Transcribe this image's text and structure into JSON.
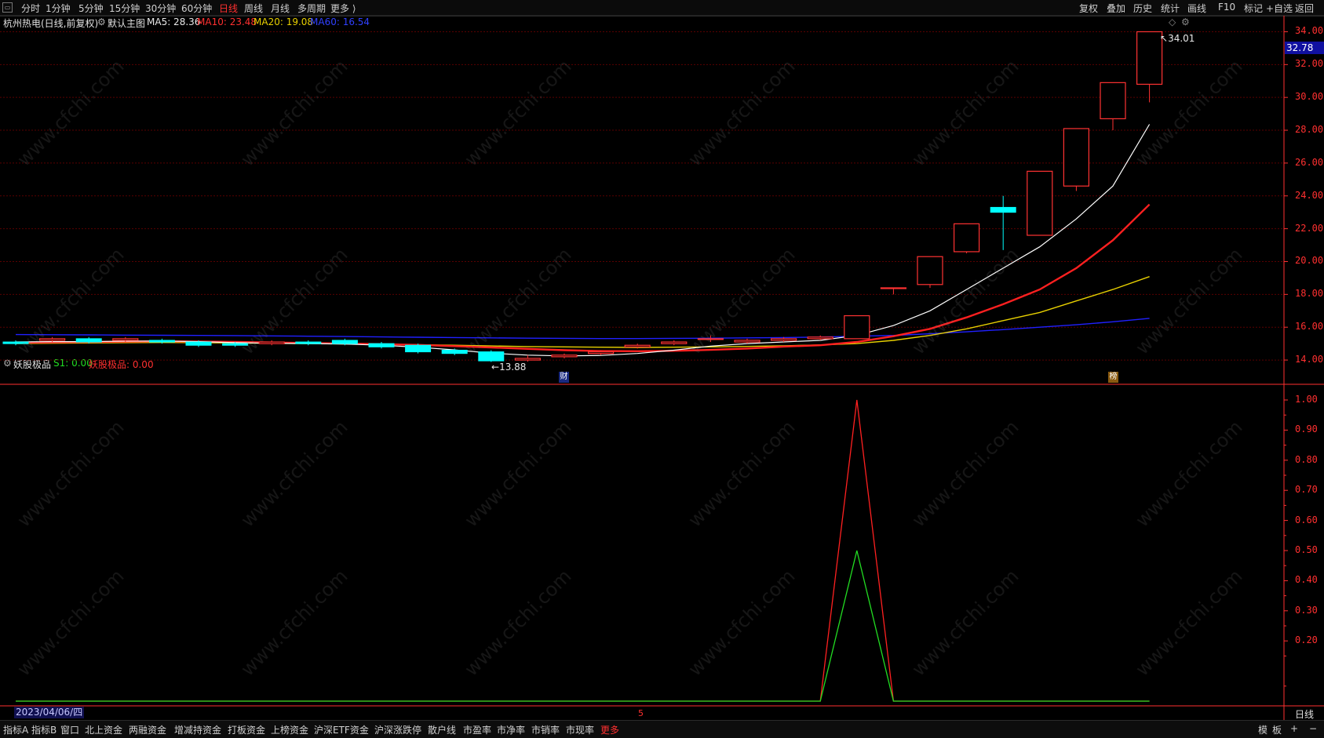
{
  "toolbar": {
    "periods": [
      "分时",
      "1分钟",
      "5分钟",
      "15分钟",
      "30分钟",
      "60分钟",
      "日线",
      "周线",
      "月线",
      "多周期",
      "更多 ⟩"
    ],
    "active_period": "日线",
    "right_items": [
      "复权",
      "叠加",
      "历史",
      "统计",
      "画线",
      "F10",
      "标记",
      "+自选",
      "返回"
    ]
  },
  "main_info": {
    "stock": "杭州热电(日线,前复权)",
    "template": "默认主图",
    "ma5": "MA5: 28.36",
    "ma10": "MA10: 23.48",
    "ma20": "MA20: 19.08",
    "ma60": "MA60: 16.54"
  },
  "sub_info": {
    "indicator": "妖股极品",
    "s1": "S1: 0.00",
    "signal": "妖股极品: 0.00"
  },
  "price_axis": [
    "34.00",
    "32.00",
    "30.00",
    "28.00",
    "26.00",
    "24.00",
    "22.00",
    "20.00",
    "18.00",
    "16.00",
    "14.00"
  ],
  "current_price": "32.78",
  "sub_axis": [
    "1.00",
    "0.90",
    "0.80",
    "0.70",
    "0.60",
    "0.50",
    "0.40",
    "0.30",
    "0.20"
  ],
  "labels": {
    "high": "34.01",
    "low": "13.88",
    "cai_badge": "财",
    "bang_badge": "榜",
    "date": "2023/04/06/四",
    "mid_marker": "5",
    "period_right": "日线",
    "watermark": "www.cfchi.com"
  },
  "bottom": {
    "items": [
      "指标A",
      "指标B",
      "窗口",
      "北上资金",
      "两融资金",
      "增减持资金",
      "打板资金",
      "上榜资金",
      "沪深ETF资金",
      "沪深涨跌停",
      "散户线",
      "市盈率",
      "市净率",
      "市销率",
      "市现率",
      "更多"
    ],
    "active": "更多",
    "right": [
      "模",
      "板",
      "+",
      "−"
    ]
  },
  "colors": {
    "up": "#ff3232",
    "down": "#00ffff",
    "ma5": "#ffffff",
    "ma10": "#ff2020",
    "ma20": "#e8d000",
    "ma60": "#2020ff",
    "grid": "#5a0000",
    "axis": "#ff3030"
  },
  "chart_data": [
    {
      "type": "candlestick",
      "title": "杭州热电(日线,前复权)",
      "ylim": [
        13,
        34.5
      ],
      "candles": [
        {
          "o": 15.1,
          "c": 15.0,
          "h": 15.2,
          "l": 14.9
        },
        {
          "o": 15.2,
          "c": 15.3,
          "h": 15.4,
          "l": 15.1
        },
        {
          "o": 15.3,
          "c": 15.1,
          "h": 15.4,
          "l": 15.0
        },
        {
          "o": 15.2,
          "c": 15.3,
          "h": 15.4,
          "l": 15.1
        },
        {
          "o": 15.2,
          "c": 15.1,
          "h": 15.3,
          "l": 15.0
        },
        {
          "o": 15.1,
          "c": 14.9,
          "h": 15.2,
          "l": 14.8
        },
        {
          "o": 15.0,
          "c": 14.9,
          "h": 15.1,
          "l": 14.8
        },
        {
          "o": 15.0,
          "c": 15.1,
          "h": 15.2,
          "l": 14.9
        },
        {
          "o": 15.1,
          "c": 15.0,
          "h": 15.2,
          "l": 14.9
        },
        {
          "o": 15.2,
          "c": 15.0,
          "h": 15.3,
          "l": 14.9
        },
        {
          "o": 15.0,
          "c": 14.8,
          "h": 15.1,
          "l": 14.7
        },
        {
          "o": 14.9,
          "c": 14.5,
          "h": 15.0,
          "l": 14.4
        },
        {
          "o": 14.6,
          "c": 14.4,
          "h": 14.7,
          "l": 14.3
        },
        {
          "o": 14.5,
          "c": 13.95,
          "h": 14.6,
          "l": 13.88
        },
        {
          "o": 14.0,
          "c": 14.1,
          "h": 14.3,
          "l": 13.9
        },
        {
          "o": 14.2,
          "c": 14.3,
          "h": 14.4,
          "l": 14.1
        },
        {
          "o": 14.4,
          "c": 14.5,
          "h": 14.6,
          "l": 14.3
        },
        {
          "o": 14.8,
          "c": 14.9,
          "h": 15.0,
          "l": 14.7
        },
        {
          "o": 15.0,
          "c": 15.1,
          "h": 15.2,
          "l": 14.9
        },
        {
          "o": 15.3,
          "c": 15.3,
          "h": 15.5,
          "l": 15.1
        },
        {
          "o": 15.1,
          "c": 15.2,
          "h": 15.3,
          "l": 15.0
        },
        {
          "o": 15.2,
          "c": 15.3,
          "h": 15.4,
          "l": 15.1
        },
        {
          "o": 15.3,
          "c": 15.4,
          "h": 15.5,
          "l": 15.2
        },
        {
          "o": 15.3,
          "c": 16.7,
          "h": 16.7,
          "l": 15.3
        },
        {
          "o": 18.4,
          "c": 18.4,
          "h": 18.4,
          "l": 18.0
        },
        {
          "o": 18.6,
          "c": 20.3,
          "h": 20.3,
          "l": 18.4
        },
        {
          "o": 20.6,
          "c": 22.3,
          "h": 22.3,
          "l": 20.5
        },
        {
          "o": 23.3,
          "c": 23.0,
          "h": 24.0,
          "l": 20.7
        },
        {
          "o": 21.6,
          "c": 25.5,
          "h": 25.5,
          "l": 21.6
        },
        {
          "o": 24.6,
          "c": 28.1,
          "h": 28.1,
          "l": 24.3
        },
        {
          "o": 28.7,
          "c": 30.9,
          "h": 30.9,
          "l": 28.0
        },
        {
          "o": 30.8,
          "c": 34.0,
          "h": 34.01,
          "l": 29.7
        }
      ],
      "ma5": [
        15.1,
        15.12,
        15.12,
        15.15,
        15.16,
        15.12,
        15.06,
        15.02,
        15.0,
        14.98,
        14.9,
        14.78,
        14.62,
        14.42,
        14.3,
        14.25,
        14.28,
        14.4,
        14.6,
        14.85,
        15.0,
        15.1,
        15.2,
        15.5,
        16.1,
        17.0,
        18.3,
        19.6,
        20.9,
        22.6,
        24.6,
        28.36
      ],
      "ma10": [
        15.05,
        15.08,
        15.1,
        15.12,
        15.14,
        15.13,
        15.1,
        15.07,
        15.04,
        15.0,
        14.97,
        14.92,
        14.85,
        14.77,
        14.68,
        14.6,
        14.55,
        14.54,
        14.56,
        14.62,
        14.7,
        14.82,
        14.9,
        15.1,
        15.45,
        15.9,
        16.6,
        17.4,
        18.3,
        19.6,
        21.3,
        23.48
      ],
      "ma20": [
        15.0,
        15.02,
        15.04,
        15.06,
        15.07,
        15.06,
        15.04,
        15.02,
        15.0,
        14.98,
        14.96,
        14.93,
        14.9,
        14.86,
        14.82,
        14.8,
        14.78,
        14.77,
        14.78,
        14.8,
        14.83,
        14.87,
        14.92,
        15.0,
        15.2,
        15.5,
        15.9,
        16.4,
        16.9,
        17.6,
        18.3,
        19.08
      ],
      "ma60": [
        15.55,
        15.54,
        15.53,
        15.52,
        15.51,
        15.5,
        15.49,
        15.47,
        15.45,
        15.43,
        15.41,
        15.39,
        15.37,
        15.35,
        15.33,
        15.32,
        15.31,
        15.31,
        15.32,
        15.33,
        15.35,
        15.37,
        15.4,
        15.45,
        15.5,
        15.6,
        15.72,
        15.85,
        16.0,
        16.15,
        16.33,
        16.54
      ]
    },
    {
      "type": "line",
      "title": "妖股极品",
      "ylim": [
        0,
        1.0
      ],
      "series": [
        {
          "name": "妖股极品",
          "values": [
            0,
            0,
            0,
            0,
            0,
            0,
            0,
            0,
            0,
            0,
            0,
            0,
            0,
            0,
            0,
            0,
            0,
            0,
            0,
            0,
            0,
            0,
            0,
            1,
            0,
            0,
            0,
            0,
            0,
            0,
            0,
            0
          ]
        },
        {
          "name": "S1",
          "values": [
            0,
            0,
            0,
            0,
            0,
            0,
            0,
            0,
            0,
            0,
            0,
            0,
            0,
            0,
            0,
            0,
            0,
            0,
            0,
            0,
            0,
            0,
            0,
            0.5,
            0,
            0,
            0,
            0,
            0,
            0,
            0,
            0
          ]
        }
      ]
    }
  ]
}
